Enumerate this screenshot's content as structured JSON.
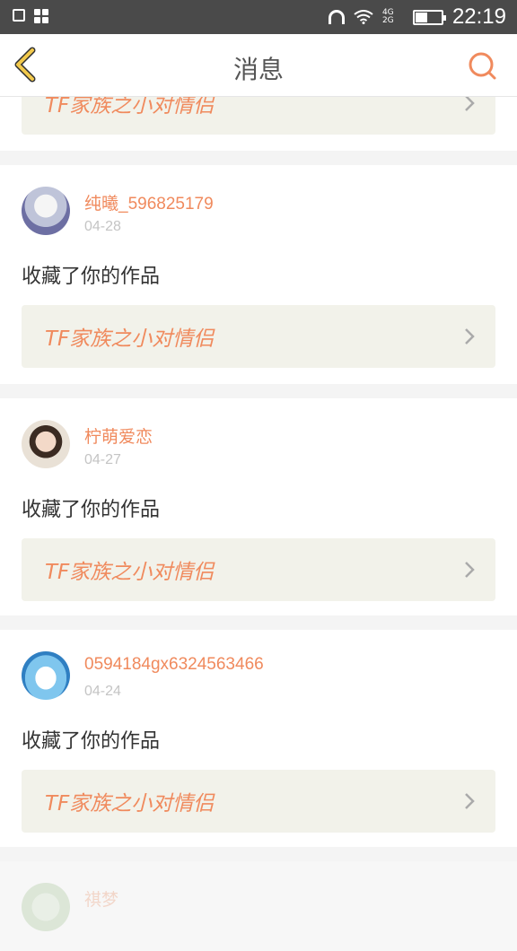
{
  "status_bar": {
    "time": "22:19",
    "network": "4G 2G",
    "battery_level": 0.45
  },
  "header": {
    "title": "消息"
  },
  "notifications": [
    {
      "work_title": "TF家族之小对情侣"
    },
    {
      "username": "纯曦_596825179",
      "date": "04-28",
      "message": "收藏了你的作品",
      "work_title": "TF家族之小对情侣"
    },
    {
      "username": "柠萌爱恋",
      "date": "04-27",
      "message": "收藏了你的作品",
      "work_title": "TF家族之小对情侣"
    },
    {
      "username": "0594184gx6324563466",
      "date": "04-24",
      "message": "收藏了你的作品",
      "work_title": "TF家族之小对情侣"
    },
    {
      "username": "祺梦"
    }
  ],
  "colors": {
    "accent": "#f08a5d",
    "back_icon": "#f2c94c"
  }
}
